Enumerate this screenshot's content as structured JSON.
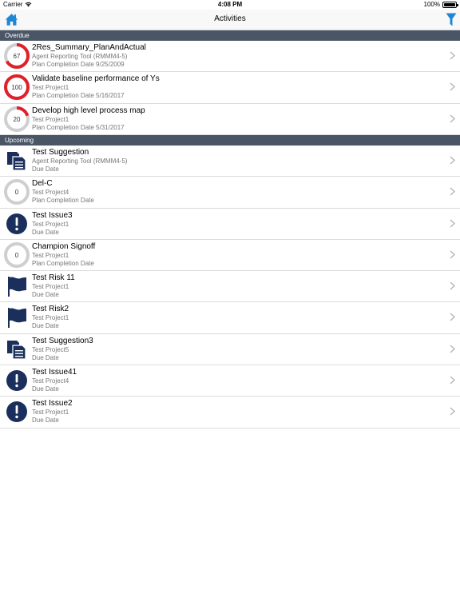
{
  "status_bar": {
    "carrier": "Carrier",
    "time": "4:08 PM",
    "battery": "100%"
  },
  "nav": {
    "title": "Activities"
  },
  "colors": {
    "navy": "#1b2f5c",
    "accent_blue": "#1e88d6",
    "ring_red": "#e0202a",
    "ring_gray": "#cfcfcf",
    "header_bg": "#4a5566"
  },
  "sections": {
    "overdue": {
      "label": "Overdue",
      "items": [
        {
          "icon": "progress-ring",
          "progress": 67,
          "progress_label": "67",
          "title": "2Res_Summary_PlanAndActual",
          "subtitle": "Agent Reporting Tool (RMMM4-5)",
          "date": "Plan Completion Date 9/25/2009"
        },
        {
          "icon": "progress-ring",
          "progress": 100,
          "progress_label": "100",
          "title": "Validate baseline performance of Ys",
          "subtitle": "Test Project1",
          "date": "Plan Completion Date 5/16/2017"
        },
        {
          "icon": "progress-ring",
          "progress": 20,
          "progress_label": "20",
          "title": "Develop high level process map",
          "subtitle": "Test Project1",
          "date": "Plan Completion Date 5/31/2017"
        }
      ]
    },
    "upcoming": {
      "label": "Upcoming",
      "items": [
        {
          "icon": "document-icon",
          "title": "Test Suggestion",
          "subtitle": "Agent Reporting Tool (RMMM4-5)",
          "date": "Due Date"
        },
        {
          "icon": "progress-ring",
          "progress": 0,
          "progress_label": "0",
          "title": "Del-C",
          "subtitle": "Test Project4",
          "date": "Plan Completion Date"
        },
        {
          "icon": "issue-icon",
          "title": "Test Issue3",
          "subtitle": "Test Project1",
          "date": "Due Date"
        },
        {
          "icon": "progress-ring",
          "progress": 0,
          "progress_label": "0",
          "title": "Champion Signoff",
          "subtitle": "Test Project1",
          "date": "Plan Completion Date"
        },
        {
          "icon": "flag-icon",
          "title": "Test Risk 11",
          "subtitle": "Test Project1",
          "date": "Due Date"
        },
        {
          "icon": "flag-icon",
          "title": "Test Risk2",
          "subtitle": "Test Project1",
          "date": "Due Date"
        },
        {
          "icon": "document-icon",
          "title": "Test Suggestion3",
          "subtitle": "Test Project5",
          "date": "Due Date"
        },
        {
          "icon": "issue-icon",
          "title": "Test Issue41",
          "subtitle": "Test Project4",
          "date": "Due Date"
        },
        {
          "icon": "issue-icon",
          "title": "Test Issue2",
          "subtitle": "Test Project1",
          "date": "Due Date"
        }
      ]
    }
  }
}
